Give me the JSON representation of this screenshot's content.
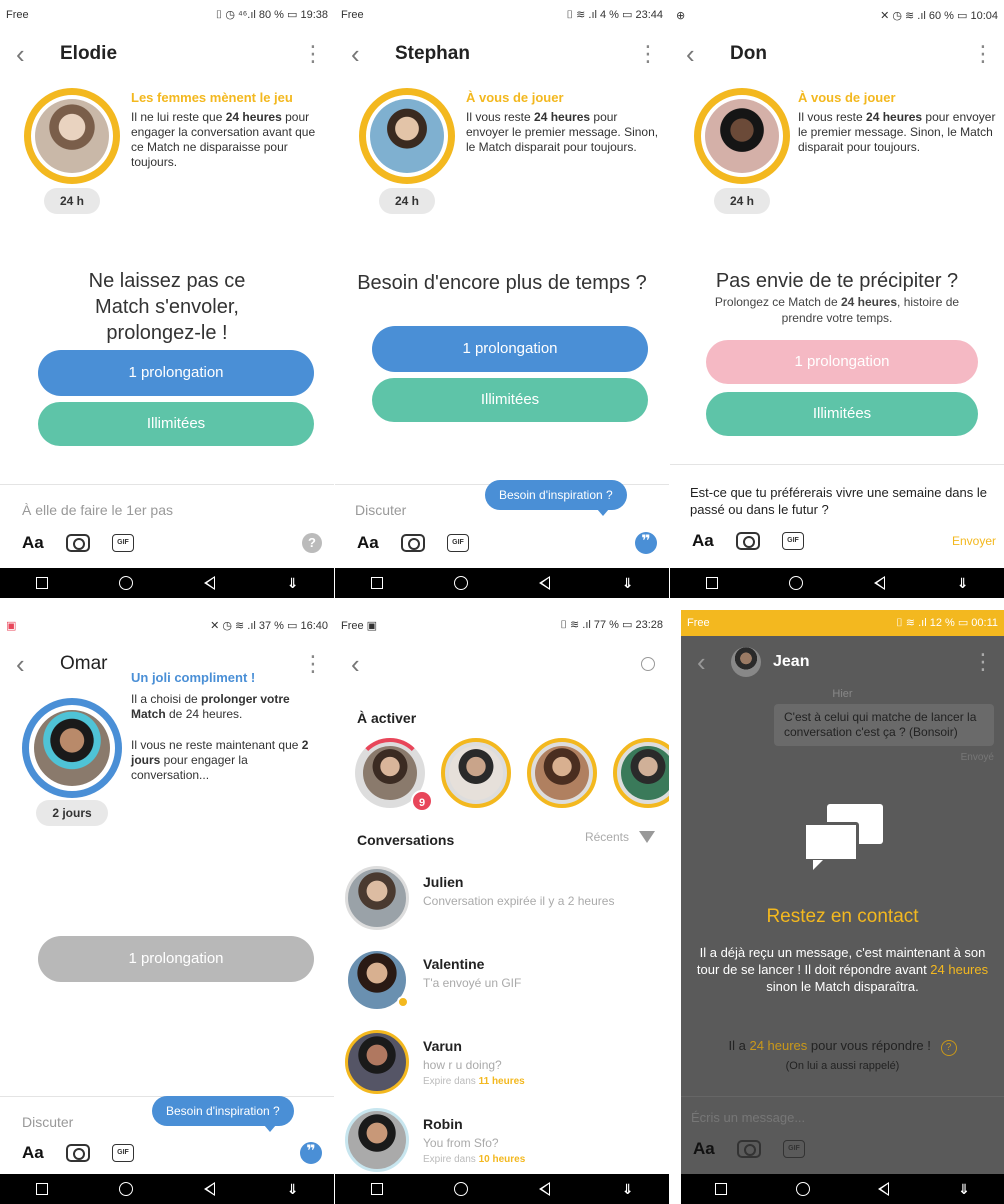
{
  "panels": {
    "elodie": {
      "status_left": "Free",
      "status_right": "⌷ ◷ ⁴⁶.ıl 80 % ▭ 19:38",
      "name": "Elodie",
      "msg_title": "Les femmes mènent le jeu",
      "msg_pre": "Il ne lui reste que ",
      "msg_bold": "24 heures",
      "msg_post": " pour engager la conversation avant que ce Match ne disparaisse pour toujours.",
      "time_pill": "24 h",
      "center_title": "Ne laissez pas ce Match s'envoler, prolongez-le !",
      "btn1": "1 prolongation",
      "btn2": "Illimitées",
      "compose_placeholder": "À elle de faire le 1er pas",
      "aa": "Aa",
      "gif": "GIF",
      "help": "?"
    },
    "stephan": {
      "status_left": "Free",
      "status_right": "⌷ ≋ .ıl 4 % ▭ 23:44",
      "name": "Stephan",
      "msg_title": "À vous de jouer",
      "msg_pre": "Il vous reste ",
      "msg_bold": "24 heures",
      "msg_post": " pour envoyer le premier message. Sinon, le Match disparait pour toujours.",
      "time_pill": "24 h",
      "center_title": "Besoin d'encore plus de temps ?",
      "btn1": "1 prolongation",
      "btn2": "Illimitées",
      "compose_placeholder": "Discuter",
      "tooltip": "Besoin d'inspiration ?",
      "aa": "Aa",
      "gif": "GIF",
      "quote": "❞"
    },
    "don": {
      "status_left": "⊕",
      "status_right": "✕ ◷ ≋ .ıl 60 % ▭ 10:04",
      "name": "Don",
      "msg_title": "À vous de jouer",
      "msg_pre": "Il vous reste ",
      "msg_bold": "24 heures",
      "msg_post": " pour envoyer le premier message. Sinon, le Match disparait pour toujours.",
      "time_pill": "24 h",
      "center_title": "Pas envie de te précipiter ?",
      "center_sub_pre": "Prolongez ce Match de ",
      "center_sub_bold": "24 heures",
      "center_sub_post": ", histoire de prendre votre temps.",
      "btn1": "1 prolongation",
      "btn2": "Illimitées",
      "compose_text": "Est-ce que tu préférerais vivre une semaine dans le passé ou dans le futur ?",
      "send": "Envoyer",
      "aa": "Aa",
      "gif": "GIF"
    },
    "omar": {
      "status_left": "▣",
      "status_right": "✕ ◷ ≋ .ıl 37 % ▭ 16:40",
      "name": "Omar",
      "msg_title": "Un joli compliment !",
      "msg1_pre": "Il a choisi de ",
      "msg1_bold": "prolonger votre",
      "msg1_mid": " ",
      "msg1_bold2": "Match",
      "msg1_post": " de 24 heures.",
      "msg2_pre": "Il vous ne reste maintenant que ",
      "msg2_bold": "2 jours",
      "msg2_post": " pour engager la conversation...",
      "time_pill": "2 jours",
      "btn1": "1 prolongation",
      "compose_placeholder": "Discuter",
      "tooltip": "Besoin d'inspiration ?",
      "aa": "Aa",
      "gif": "GIF",
      "quote": "❞"
    },
    "list": {
      "status_left": "Free ▣",
      "status_right": "⌷ ≋ .ıl 77 % ▭ 23:28",
      "to_activate": "À activer",
      "badge": "9",
      "conversations": "Conversations",
      "sort": "Récents",
      "rows": [
        {
          "name": "Julien",
          "last": "Conversation expirée il y a 2 heures",
          "exp_pre": "",
          "exp_bold": "",
          "exp_post": ""
        },
        {
          "name": "Valentine",
          "last": "T'a envoyé un GIF",
          "exp_pre": "",
          "exp_bold": "",
          "exp_post": ""
        },
        {
          "name": "Varun",
          "last": "how r u doing?",
          "exp_pre": "Expire dans ",
          "exp_bold": "11 heures",
          "exp_post": ""
        },
        {
          "name": "Robin",
          "last": "You from Sfo?",
          "exp_pre": "Expire dans ",
          "exp_bold": "10 heures",
          "exp_post": ""
        }
      ]
    },
    "jean": {
      "status_left": "Free",
      "status_right": "⌷ ≋ .ıl 12 % ▭ 00:11",
      "name": "Jean",
      "day": "Hier",
      "bubble": "C'est à celui qui matche de lancer la conversation c'est ça ? (Bonsoir)",
      "sent": "Envoyé",
      "title": "Restez en contact",
      "body_pre": "Il a déjà reçu un message, c'est maintenant à son tour de se lancer ! Il doit répondre avant ",
      "body_bold": "24 heures",
      "body_post": " sinon le Match disparaîtra.",
      "line_pre": "Il a ",
      "line_bold": "24 heures",
      "line_post": " pour vous répondre !",
      "reminded": "(On lui a aussi rappelé)",
      "compose_placeholder": "Écris un message...",
      "aa": "Aa",
      "gif": "GIF",
      "help": "?"
    }
  },
  "colors": {
    "yellow": "#f3b81f",
    "blue": "#4a8fd6",
    "green": "#5ec4a8",
    "pink": "#f5b9c4",
    "grey_btn": "#b8b8b8",
    "dark_overlay": "#5a5a5a"
  }
}
